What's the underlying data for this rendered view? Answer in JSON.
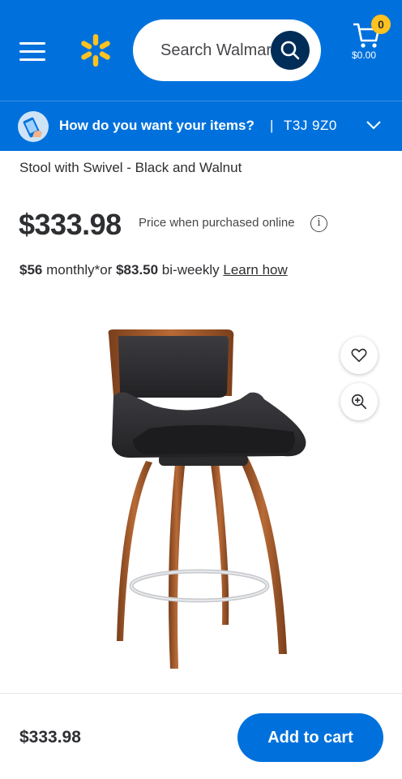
{
  "header": {
    "search_placeholder": "Search Walmart",
    "cart_count": "0",
    "cart_total": "$0.00",
    "brand_color": "#0071dc",
    "accent_color": "#ffc220"
  },
  "fulfillment": {
    "question": "How do you want your items?",
    "separator": "|",
    "postal_code": "T3J 9Z0"
  },
  "product": {
    "title_line": "Stool with Swivel - Black and Walnut",
    "price": "$333.98",
    "price_note": "Price when purchased online",
    "installment": {
      "monthly_amount": "$56",
      "monthly_text": " monthly*or ",
      "biweekly_amount": "$83.50",
      "biweekly_text": " bi-weekly ",
      "learn_link": "Learn how"
    }
  },
  "icons": {
    "menu": "hamburger-menu-icon",
    "logo": "walmart-spark-icon",
    "search": "search-icon",
    "cart": "cart-icon",
    "fulfillment": "delivery-phone-icon",
    "chevron": "chevron-down-icon",
    "info": "info-icon",
    "favorite": "heart-icon",
    "zoom": "zoom-in-icon"
  },
  "footer": {
    "price": "$333.98",
    "add_to_cart_label": "Add to cart"
  }
}
